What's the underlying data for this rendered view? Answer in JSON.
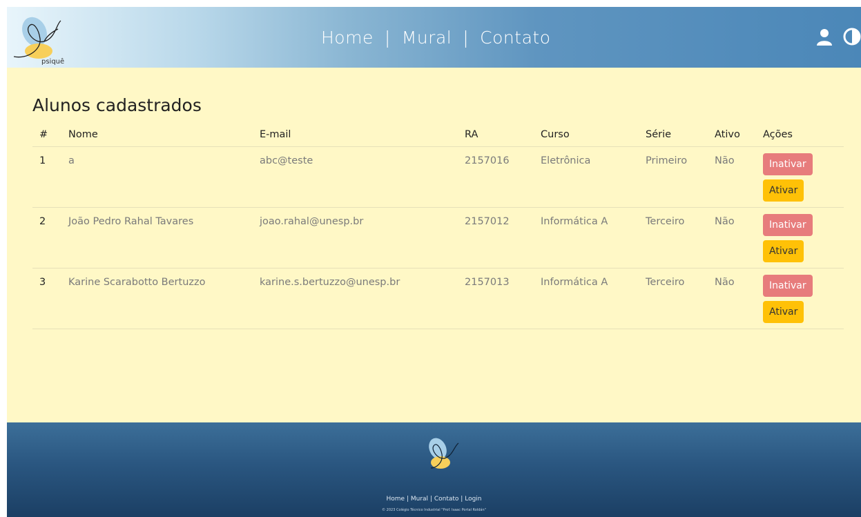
{
  "header": {
    "logo_text": "psiquê",
    "nav": [
      {
        "label": "Home"
      },
      {
        "label": "Mural"
      },
      {
        "label": "Contato"
      }
    ],
    "separator": "|",
    "icons": [
      "user-icon",
      "contrast-icon"
    ],
    "gradient_colors": [
      "#e8f5fb",
      "#4b87b8"
    ]
  },
  "main": {
    "title": "Alunos cadastrados",
    "background": "#fff8c6",
    "columns": [
      "#",
      "Nome",
      "E-mail",
      "RA",
      "Curso",
      "Série",
      "Ativo",
      "Ações"
    ],
    "rows": [
      {
        "num": "1",
        "nome": "a",
        "email": "abc@teste",
        "ra": "2157016",
        "curso": "Eletrônica",
        "serie": "Primeiro",
        "ativo": "Não"
      },
      {
        "num": "2",
        "nome": "João Pedro Rahal Tavares",
        "email": "joao.rahal@unesp.br",
        "ra": "2157012",
        "curso": "Informática A",
        "serie": "Terceiro",
        "ativo": "Não"
      },
      {
        "num": "3",
        "nome": "Karine Scarabotto Bertuzzo",
        "email": "karine.s.bertuzzo@unesp.br",
        "ra": "2157013",
        "curso": "Informática A",
        "serie": "Terceiro",
        "ativo": "Não"
      }
    ],
    "actions": {
      "deactivate_label": "Inativar",
      "activate_label": "Ativar",
      "deactivate_color": "#e77c7c",
      "activate_color": "#ffc107"
    }
  },
  "footer": {
    "links": [
      {
        "label": "Home"
      },
      {
        "label": "Mural"
      },
      {
        "label": "Contato"
      },
      {
        "label": "Login"
      }
    ],
    "separator": "|",
    "copyright": "© 2023 Colégio Técnico Industrial \"Prof. Isaac Portal Roldán\"",
    "gradient_colors": [
      "#3c6f99",
      "#1b3f64"
    ]
  }
}
